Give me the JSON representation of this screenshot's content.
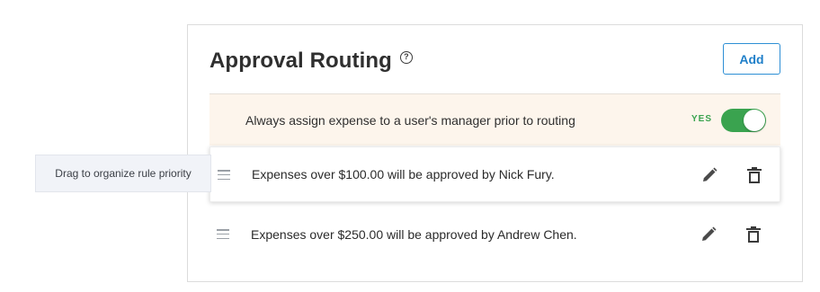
{
  "panel": {
    "title": "Approval Routing",
    "help_icon": "question-circle-icon",
    "add_label": "Add"
  },
  "manager_setting": {
    "text": "Always assign expense to a user's manager prior to routing",
    "toggle_label": "YES",
    "toggle_on": true,
    "toggle_color": "#3aa34f"
  },
  "rules": [
    {
      "text": "Expenses over $100.00 will be approved by Nick Fury."
    },
    {
      "text": "Expenses over $250.00 will be approved by Andrew Chen."
    }
  ],
  "tooltip": {
    "text": "Drag to organize rule priority"
  },
  "colors": {
    "accent": "#2d8fd5",
    "highlight_bg": "#fdf5ec",
    "success": "#3aa34f"
  }
}
